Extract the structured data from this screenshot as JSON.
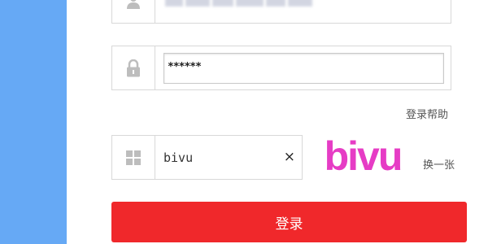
{
  "login_form": {
    "password_value": "******",
    "captcha_value": "bivu",
    "captcha_image_text": "bivu",
    "help_link": "登录帮助",
    "refresh_captcha": "换一张",
    "submit_label": "登录",
    "clear_symbol": "×"
  },
  "colors": {
    "side_panel": "#66a9f5",
    "captcha_text": "#e63cc5",
    "submit_button": "#f0282b"
  },
  "icons": {
    "username": "user-icon",
    "password": "lock-icon",
    "captcha": "grid-icon",
    "clear": "close-icon"
  }
}
